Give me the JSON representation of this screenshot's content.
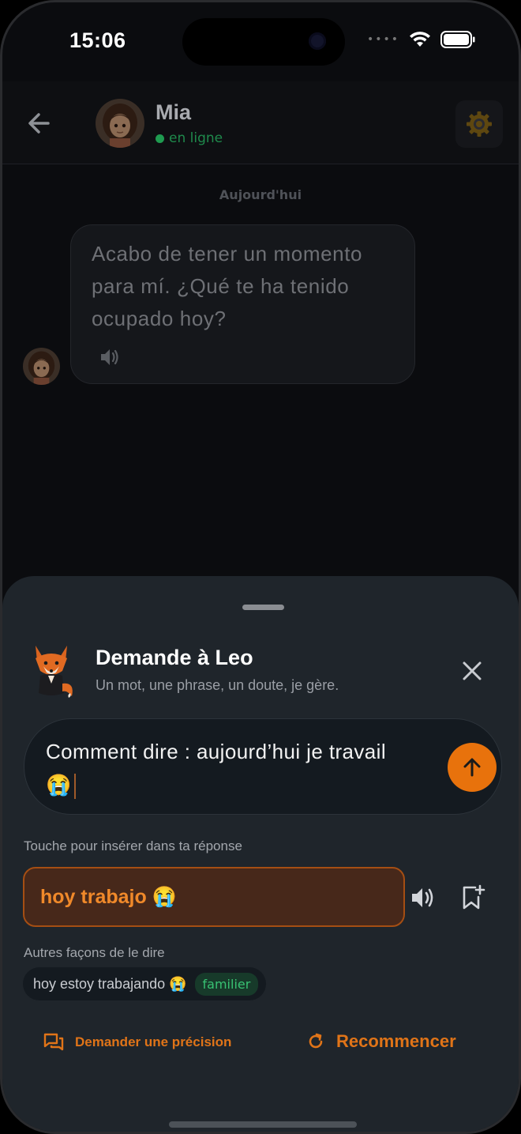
{
  "status_bar": {
    "time": "15:06"
  },
  "header": {
    "contact_name": "Mia",
    "contact_status": "en ligne"
  },
  "chat": {
    "date_separator": "Aujourd'hui",
    "messages": [
      {
        "text": "Acabo de tener un momento para mí. ¿Qué te ha tenido ocupado hoy?"
      }
    ]
  },
  "sheet": {
    "title": "Demande à Leo",
    "subtitle": "Un mot, une phrase, un doute, je gère.",
    "input_value": "Comment dire : aujourd’hui je travail 😭",
    "insert_hint": "Touche pour insérer dans ta réponse",
    "answer": "hoy trabajo 😭",
    "alternatives_label": "Autres façons de le dire",
    "alternatives": [
      {
        "text": "hoy estoy trabajando 😭",
        "tag": "familier"
      }
    ],
    "action_clarify": "Demander une précision",
    "action_restart": "Recommencer"
  },
  "colors": {
    "accent": "#e8720c",
    "online": "#1f9b50",
    "sheet_bg": "#1f252b",
    "answer_bg": "#47281a"
  },
  "icons": [
    "back-arrow-icon",
    "settings-icon",
    "speaker-icon",
    "close-icon",
    "send-arrow-icon",
    "bookmark-add-icon",
    "chat-bubbles-icon",
    "refresh-icon"
  ]
}
